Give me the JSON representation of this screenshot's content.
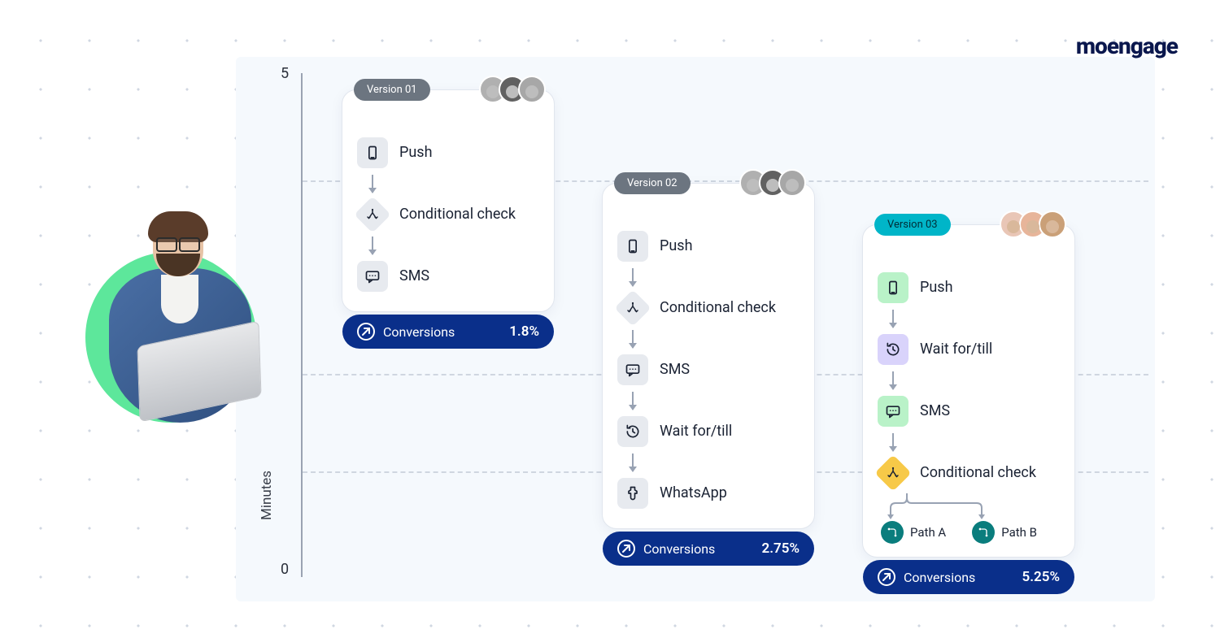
{
  "brand": "moengage",
  "axis": {
    "title": "Minutes",
    "top": "5",
    "bottom": "0"
  },
  "versions": [
    {
      "label": "Version 01",
      "pillClass": "vp-gray",
      "avatarsGray": true,
      "steps": [
        {
          "icon": "push",
          "bg": "bg-gray",
          "label": "Push"
        },
        {
          "icon": "conditional",
          "bg": "bg-gray",
          "label": "Conditional check",
          "diamond": true
        },
        {
          "icon": "sms",
          "bg": "bg-gray",
          "label": "SMS"
        }
      ],
      "paths": null,
      "conversionLabel": "Conversions",
      "conversionValue": "1.8%"
    },
    {
      "label": "Version 02",
      "pillClass": "vp-gray",
      "avatarsGray": true,
      "steps": [
        {
          "icon": "push",
          "bg": "bg-gray",
          "label": "Push"
        },
        {
          "icon": "conditional",
          "bg": "bg-gray",
          "label": "Conditional check",
          "diamond": true
        },
        {
          "icon": "sms",
          "bg": "bg-gray",
          "label": "SMS"
        },
        {
          "icon": "wait",
          "bg": "bg-gray",
          "label": "Wait for/till"
        },
        {
          "icon": "whatsapp",
          "bg": "bg-gray",
          "label": "WhatsApp"
        }
      ],
      "paths": null,
      "conversionLabel": "Conversions",
      "conversionValue": "2.75%"
    },
    {
      "label": "Version 03",
      "pillClass": "vp-teal",
      "avatarsGray": false,
      "steps": [
        {
          "icon": "push",
          "bg": "bg-green",
          "label": "Push"
        },
        {
          "icon": "wait",
          "bg": "bg-lilac",
          "label": "Wait for/till"
        },
        {
          "icon": "sms",
          "bg": "bg-green",
          "label": "SMS"
        },
        {
          "icon": "conditional",
          "bg": "bg-amber",
          "label": "Conditional check",
          "diamond": true
        }
      ],
      "paths": {
        "a": "Path A",
        "b": "Path B"
      },
      "conversionLabel": "Conversions",
      "conversionValue": "5.25%"
    }
  ]
}
